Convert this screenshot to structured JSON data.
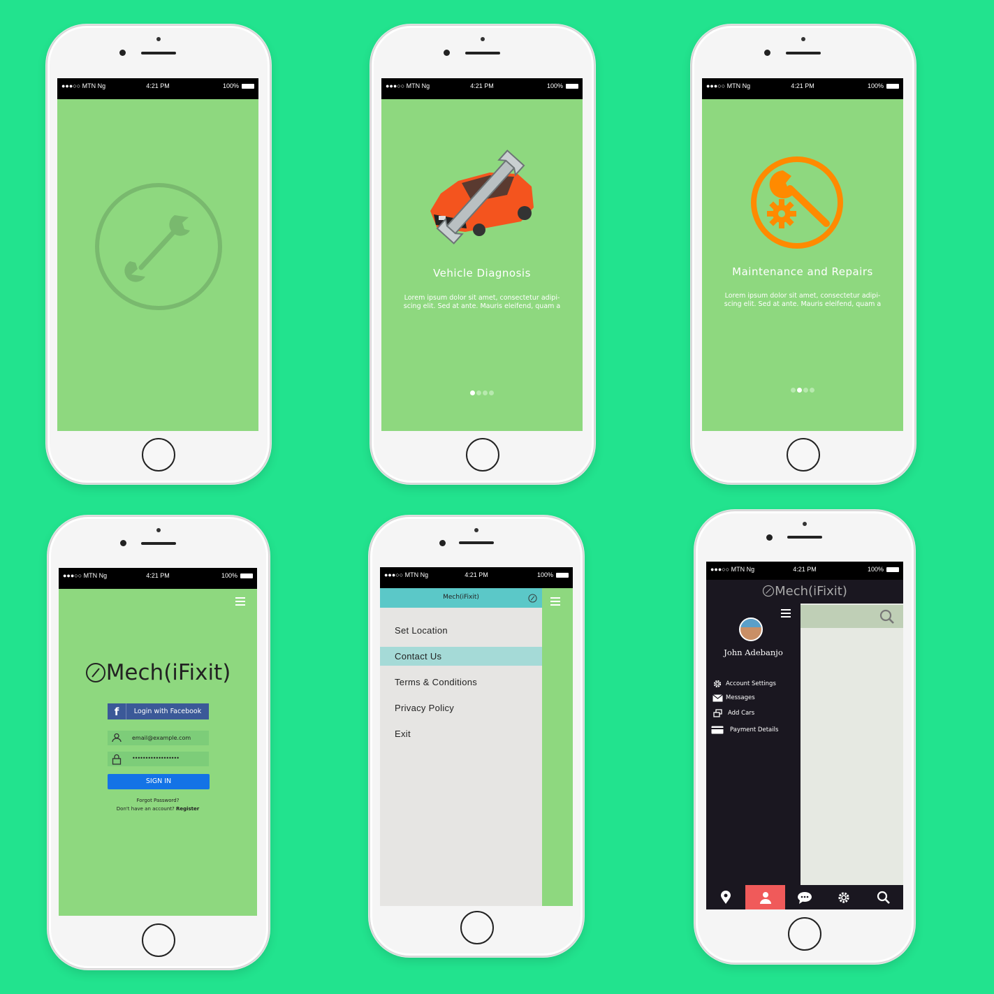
{
  "status_bar": {
    "carrier": "●●●○○ MTN Ng",
    "time": "4:21 PM",
    "battery": "100%"
  },
  "onboarding": [
    {
      "title": "Vehicle Diagnosis",
      "body_line1": "Lorem ipsum dolor sit amet, consectetur adipi-",
      "body_line2": "scing elit. Sed at ante. Mauris eleifend, quam a",
      "active_page": 1,
      "pages": 4
    },
    {
      "title": "Maintenance and Repairs",
      "body_line1": "Lorem ipsum dolor sit amet, consectetur adipi-",
      "body_line2": "scing elit. Sed at ante. Mauris eleifend, quam a",
      "active_page": 2,
      "pages": 4
    }
  ],
  "login": {
    "logo_text": "Mech(iFixit)",
    "facebook_label": "Login with Facebook",
    "email_placeholder": "email@example.com",
    "password_mask": "••••••••••••••••••",
    "signin_label": "SIGN IN",
    "forgot_label": "Forgot Password?",
    "no_account_label": "Don't have an account?",
    "register_label": "Register"
  },
  "side_menu": {
    "header_title": "Mech(iFixit)",
    "items": [
      "Set Location",
      "Contact Us",
      "Terms & Conditions",
      "Privacy Policy",
      "Exit"
    ],
    "selected": "Contact Us"
  },
  "drawer": {
    "header_title": "Mech(iFixit)",
    "user_name": "John Adebanjo",
    "items": [
      {
        "label": "Account Settings",
        "icon": "gear-icon"
      },
      {
        "label": "Messages",
        "icon": "envelope-icon"
      },
      {
        "label": "Add Cars",
        "icon": "cars-icon"
      },
      {
        "label": "Payment Details",
        "icon": "card-icon"
      }
    ],
    "tabs": [
      "location-icon",
      "profile-icon",
      "chat-icon",
      "settings-icon",
      "search-icon"
    ],
    "active_tab": "profile-icon"
  },
  "colors": {
    "background": "#22e38e",
    "screen_green": "#8ed87f",
    "accent_orange": "#ff8a00",
    "teal_header": "#5bc8c8",
    "facebook_blue": "#3b5998",
    "signin_blue": "#1473e6",
    "drawer_dark": "#1a1720",
    "active_tab": "#f05a5a"
  }
}
